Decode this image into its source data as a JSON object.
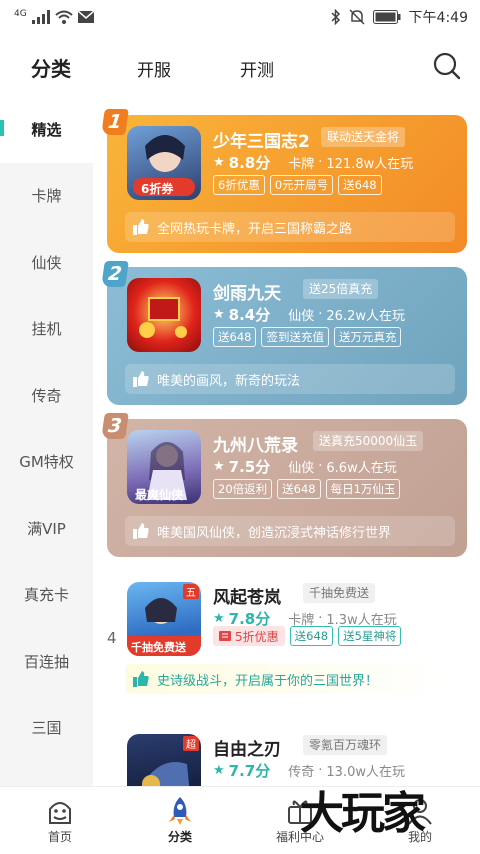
{
  "status_bar": {
    "network": "4G",
    "time": "下午4:49"
  },
  "top_tabs": {
    "active": "分类",
    "tab2": "开服",
    "tab3": "开测"
  },
  "sidebar": {
    "items": [
      "精选",
      "卡牌",
      "仙侠",
      "挂机",
      "传奇",
      "GM特权",
      "满VIP",
      "真充卡",
      "百连抽",
      "三国"
    ]
  },
  "games": [
    {
      "rank": "1",
      "name": "少年三国志2",
      "tag": "联动送天金将",
      "score": "8.8分",
      "category": "卡牌",
      "players": "121.8w人在玩",
      "chips": [
        "6折优惠",
        "0元开局号",
        "送648"
      ],
      "desc": "全网热玩卡牌，开启三国称霸之路",
      "thumb_text": "6折券",
      "color": "#f4a02c",
      "badge_color": "#f07e1e"
    },
    {
      "rank": "2",
      "name": "剑雨九天",
      "tag": "送25倍真充",
      "score": "8.4分",
      "category": "仙侠",
      "players": "26.2w人在玩",
      "chips": [
        "送648",
        "签到送充值",
        "送万元真充"
      ],
      "desc": "唯美的画风，新奇的玩法",
      "thumb_text": "",
      "color": "#86b7cf",
      "badge_color": "#4fa4c9"
    },
    {
      "rank": "3",
      "name": "九州八荒录",
      "tag": "送真充50000仙玉",
      "score": "7.5分",
      "category": "仙侠",
      "players": "6.6w人在玩",
      "chips": [
        "20倍返利",
        "送648",
        "每日1万仙玉"
      ],
      "desc": "唯美国风仙侠，创造沉浸式神话修行世界",
      "thumb_text": "最爽仙侠",
      "color": "#cbab9e",
      "badge_color": "#c98d6f"
    },
    {
      "rank": "4",
      "name": "风起苍岚",
      "tag": "千抽免费送",
      "score": "7.8分",
      "category": "卡牌",
      "players": "1.3w人在玩",
      "discount": "5折优惠",
      "chips": [
        "送648",
        "送5星神将"
      ],
      "desc": "史诗级战斗，开启属于你的三国世界！",
      "thumb_text": "千抽免费送",
      "thumb_corner": "五"
    },
    {
      "rank": "5",
      "name": "自由之刃",
      "tag": "零氪百万魂环",
      "score": "7.7分",
      "category": "传奇",
      "players": "13.0w人在玩",
      "thumb_corner": "超"
    }
  ],
  "bottom_nav": {
    "home": "首页",
    "category": "分类",
    "welfare": "福利中心",
    "mine": "我的"
  },
  "watermark": "大玩家",
  "colors": {
    "accent": "#27c4b6"
  }
}
